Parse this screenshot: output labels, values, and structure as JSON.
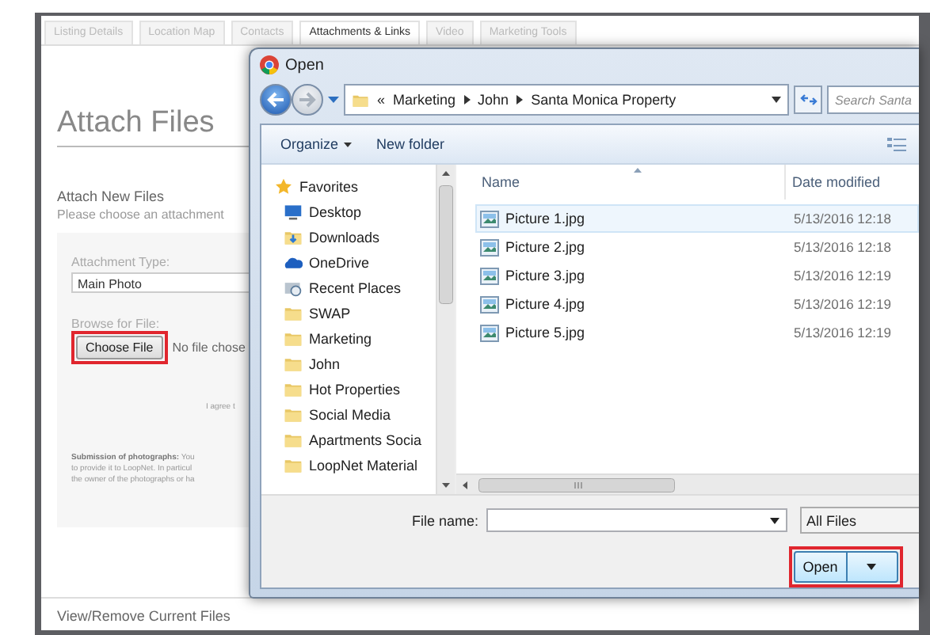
{
  "tabs": [
    {
      "label": "Listing Details",
      "selected": false
    },
    {
      "label": "Location Map",
      "selected": false
    },
    {
      "label": "Contacts",
      "selected": false
    },
    {
      "label": "Attachments & Links",
      "selected": true
    },
    {
      "label": "Video",
      "selected": false
    },
    {
      "label": "Marketing Tools",
      "selected": false
    }
  ],
  "page": {
    "title": "Attach Files",
    "section_title": "Attach New Files",
    "instructions": "Please choose an attachment",
    "attachment_type": {
      "label": "Attachment Type:",
      "value": "Main Photo"
    },
    "browse": {
      "label": "Browse for File:",
      "button": "Choose File",
      "status": "No file chose"
    },
    "agreement": "I agree t",
    "notice_lines": [
      "**Submission of photographs:** You",
      "to provide it to LoopNet. In particul",
      "the owner of the photographs or ha"
    ],
    "footer_section": "View/Remove Current Files"
  },
  "dialog": {
    "title": "Open",
    "address": {
      "overflow": "«",
      "path": [
        "Marketing",
        "John",
        "Santa Monica Property"
      ]
    },
    "search": {
      "placeholder": "Search Santa"
    },
    "toolbar": [
      "Organize",
      "New folder"
    ],
    "nav_items": [
      {
        "label": "Favorites",
        "kind": "favorites"
      },
      {
        "label": "Desktop",
        "kind": "desktop"
      },
      {
        "label": "Downloads",
        "kind": "downloads"
      },
      {
        "label": "OneDrive",
        "kind": "cloud"
      },
      {
        "label": "Recent Places",
        "kind": "recent"
      },
      {
        "label": "SWAP",
        "kind": "folder"
      },
      {
        "label": "Marketing",
        "kind": "folder"
      },
      {
        "label": "John",
        "kind": "folder"
      },
      {
        "label": "Hot Properties",
        "kind": "folder"
      },
      {
        "label": "Social Media",
        "kind": "folder"
      },
      {
        "label": "Apartments Socia",
        "kind": "folder"
      },
      {
        "label": "LoopNet Material",
        "kind": "folder"
      }
    ],
    "columns": [
      "Name",
      "Date modified"
    ],
    "files": [
      {
        "name": "Picture 1.jpg",
        "date": "5/13/2016 12:18",
        "selected": true
      },
      {
        "name": "Picture 2.jpg",
        "date": "5/13/2016 12:18",
        "selected": false
      },
      {
        "name": "Picture 3.jpg",
        "date": "5/13/2016 12:19",
        "selected": false
      },
      {
        "name": "Picture 4.jpg",
        "date": "5/13/2016 12:19",
        "selected": false
      },
      {
        "name": "Picture 5.jpg",
        "date": "5/13/2016 12:19",
        "selected": false
      }
    ],
    "file_name_label": "File name:",
    "file_type": "All Files",
    "open_button": "Open"
  }
}
